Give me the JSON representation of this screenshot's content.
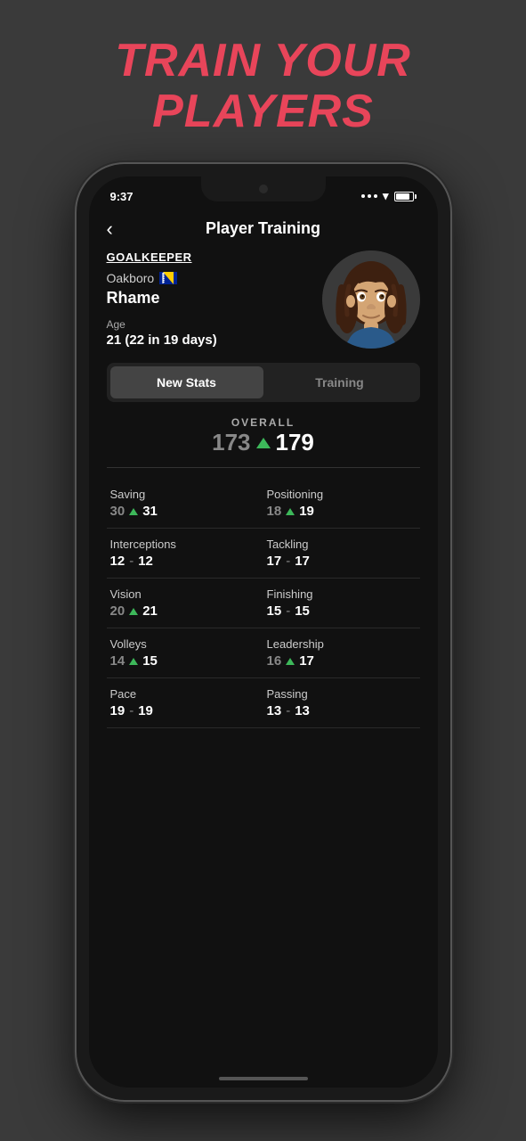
{
  "headline": {
    "line1": "TRAIN YOUR",
    "line2": "PLAYERS"
  },
  "status_bar": {
    "time": "9:37",
    "dots": 3
  },
  "header": {
    "back_label": "‹",
    "title": "Player Training"
  },
  "player": {
    "position": "GOALKEEPER",
    "club": "Oakboro",
    "name": "Rhame",
    "age_label": "Age",
    "age_value": "21 (22 in 19 days)"
  },
  "tabs": {
    "new_stats": "New Stats",
    "training": "Training"
  },
  "overall": {
    "label": "OVERALL",
    "old_value": "173",
    "new_value": "179"
  },
  "stats": [
    {
      "name": "Saving",
      "old": "30",
      "new": "31",
      "improved": true,
      "dash": false
    },
    {
      "name": "Positioning",
      "old": "18",
      "new": "19",
      "improved": true,
      "dash": false
    },
    {
      "name": "Interceptions",
      "old": "12",
      "new": "12",
      "improved": false,
      "dash": true
    },
    {
      "name": "Tackling",
      "old": "17",
      "new": "17",
      "improved": false,
      "dash": true
    },
    {
      "name": "Vision",
      "old": "20",
      "new": "21",
      "improved": true,
      "dash": false
    },
    {
      "name": "Finishing",
      "old": "15",
      "new": "15",
      "improved": false,
      "dash": true
    },
    {
      "name": "Volleys",
      "old": "14",
      "new": "15",
      "improved": true,
      "dash": false
    },
    {
      "name": "Leadership",
      "old": "16",
      "new": "17",
      "improved": true,
      "dash": false
    },
    {
      "name": "Pace",
      "old": "19",
      "new": "19",
      "improved": false,
      "dash": true
    },
    {
      "name": "Passing",
      "old": "13",
      "new": "13",
      "improved": false,
      "dash": true
    }
  ]
}
